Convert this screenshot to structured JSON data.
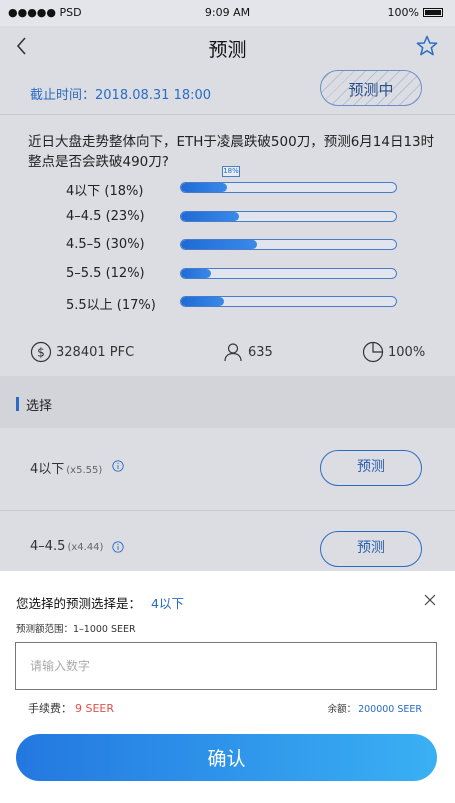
{
  "status_bar": {
    "carrier": "●●●●● PSD",
    "time": "9:09 AM",
    "battery": "100%"
  },
  "nav": {
    "title": "预测",
    "back_icon": "chevron-left-icon",
    "star_icon": "star-outline-icon"
  },
  "deadline": {
    "text": "截止时间：2018.08.31  18:00"
  },
  "status_badge": {
    "label": "预测中"
  },
  "question": {
    "text": "近日大盘走势整体向下，ETH于凌晨跌破500刀，预测6月14日13时整点是否会跌破490刀?"
  },
  "options": [
    {
      "label": "4以下 (18%)",
      "percent": 18
    },
    {
      "label": "4–4.5 (23%)",
      "percent": 23
    },
    {
      "label": "4.5–5 (30%)",
      "percent": 30
    },
    {
      "label": "5–5.5 (12%)",
      "percent": 12
    },
    {
      "label": "5.5以上 (17%)",
      "percent": 17
    }
  ],
  "tooltip": {
    "text": "18%"
  },
  "stats": {
    "pool": "328401  PFC",
    "participants": "635",
    "progress": "100%"
  },
  "section": {
    "title": "选择"
  },
  "choices": [
    {
      "name": "4以下",
      "odds": "(x5.55)",
      "button": "预测"
    },
    {
      "name": "4–4.5",
      "odds": "(x4.44)",
      "button": "预测"
    }
  ],
  "sheet": {
    "selection_label": "您选择的预测选择是：",
    "selection_value": "4以下",
    "range": "预测额范围：1–1000 SEER",
    "input_placeholder": "请输入数字",
    "fee_label": "手续费：",
    "fee_value": "9 SEER",
    "balance_label": "余额：",
    "balance_value": "200000 SEER",
    "confirm": "确认"
  },
  "colors": {
    "accent": "#2a6cc4",
    "fee": "#e0504a",
    "overlay": "#dcdde2"
  }
}
